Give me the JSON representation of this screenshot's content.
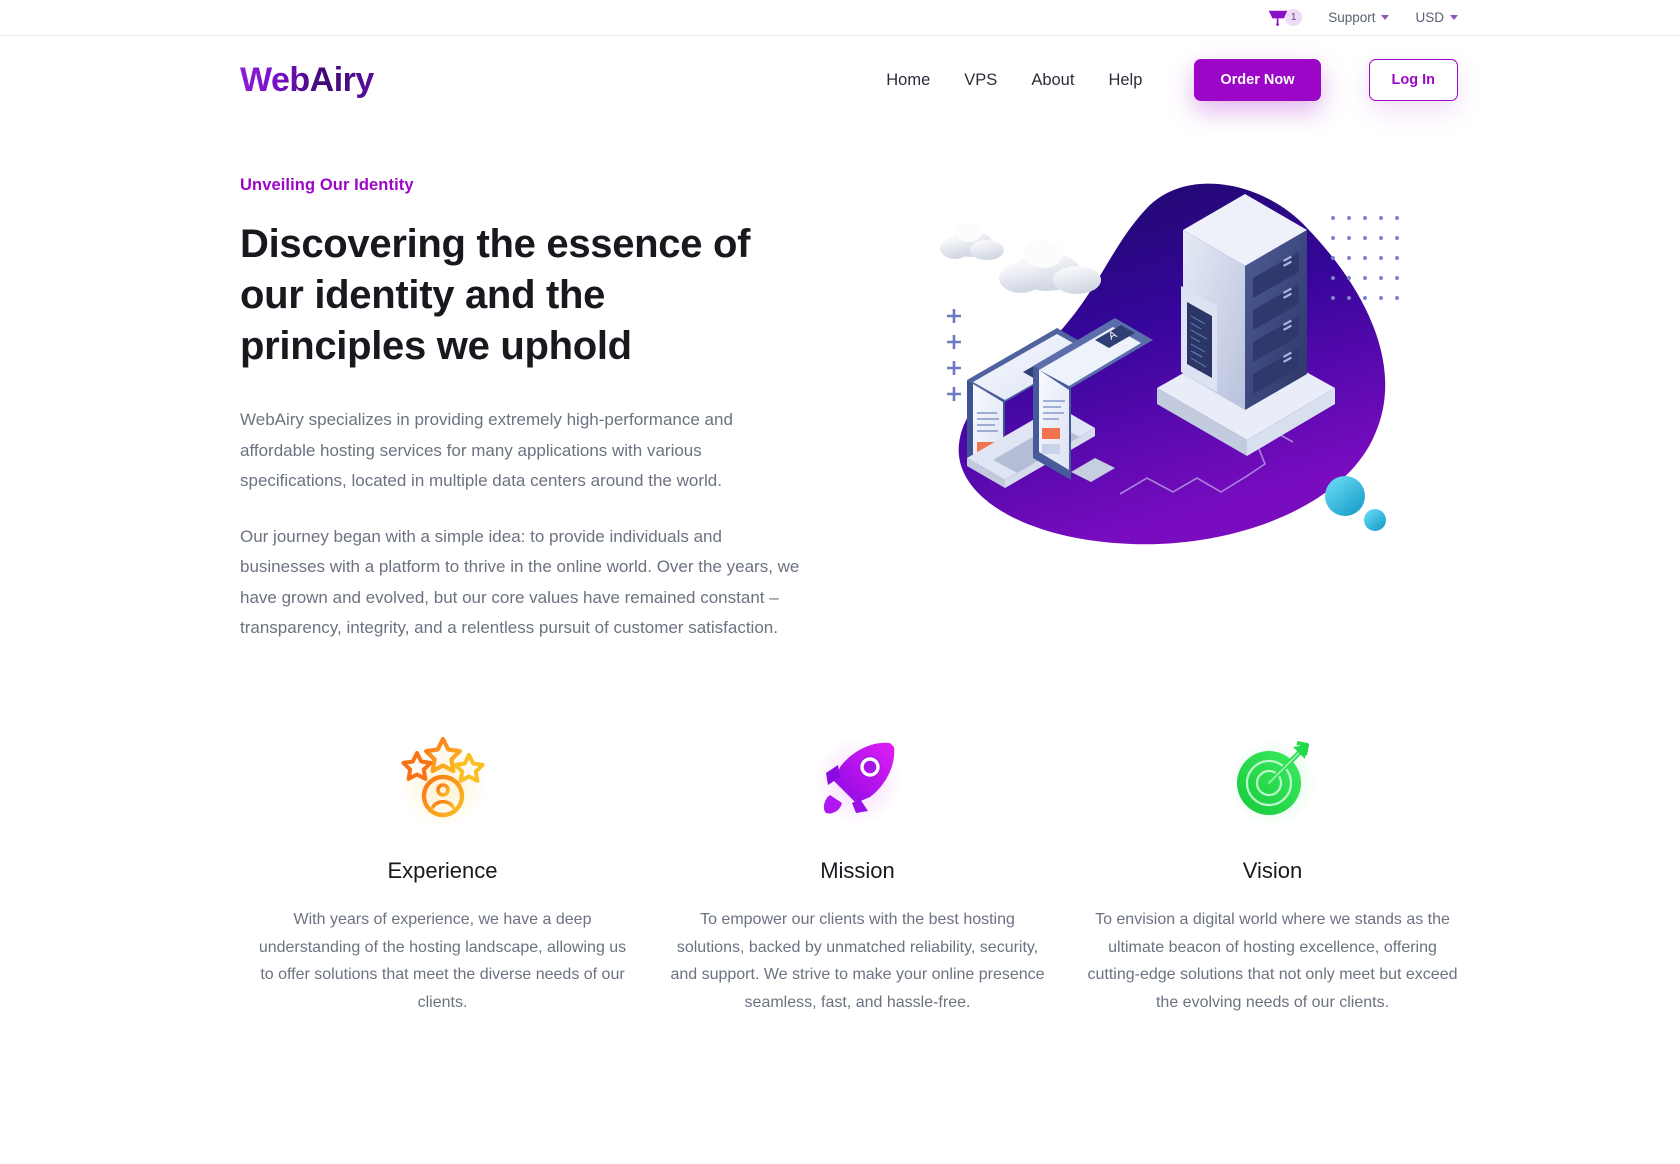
{
  "topbar": {
    "cart": {
      "icon": "shopping-cart-icon",
      "count": "1"
    },
    "support": {
      "label": "Support",
      "icon": "chevron-down-icon"
    },
    "currency": {
      "label": "USD",
      "icon": "chevron-down-icon"
    }
  },
  "header": {
    "logo": "WebAiry",
    "nav": [
      {
        "label": "Home"
      },
      {
        "label": "VPS"
      },
      {
        "label": "About"
      },
      {
        "label": "Help"
      }
    ],
    "order_button": "Order Now",
    "login_button": "Log In"
  },
  "hero": {
    "eyebrow": "Unveiling Our Identity",
    "title": "Discovering the essence of our identity and the principles we uphold",
    "paragraph1": "WebAiry specializes in providing extremely high-performance and affordable hosting services for many applications with various specifications, located in multiple data centers around the world.",
    "paragraph2": "Our journey began with a simple idea: to provide individuals and businesses with a platform to thrive in the online world. Over the years, we have grown and evolved, but our core values have remained constant – transparency, integrity, and a relentless pursuit of customer satisfaction.",
    "illustration": "isometric-server-hosting-illustration"
  },
  "features": [
    {
      "icon": "stars-user-rating-icon",
      "title": "Experience",
      "text": "With years of experience, we have a deep understanding of the hosting landscape, allowing us to offer solutions that meet the diverse needs of our clients."
    },
    {
      "icon": "rocket-icon",
      "title": "Mission",
      "text": "To empower our clients with the best hosting solutions, backed by unmatched reliability, security, and support. We strive to make your online presence seamless, fast, and hassle-free."
    },
    {
      "icon": "target-arrow-icon",
      "title": "Vision",
      "text": "To envision a digital world where we stands as the ultimate beacon of hosting excellence, offering cutting-edge solutions that not only meet but exceed the evolving needs of our clients."
    }
  ],
  "colors": {
    "brand_purple": "#9c07c7",
    "logo_dark": "#3d0a72",
    "heading": "#17191f",
    "body_text": "#6b7280",
    "blob_dark": "#1b0a6b",
    "blob_purple": "#6a0dad",
    "icon_orange": "#f59b0b",
    "icon_magenta": "#c41ef0",
    "icon_green": "#22d94a"
  }
}
